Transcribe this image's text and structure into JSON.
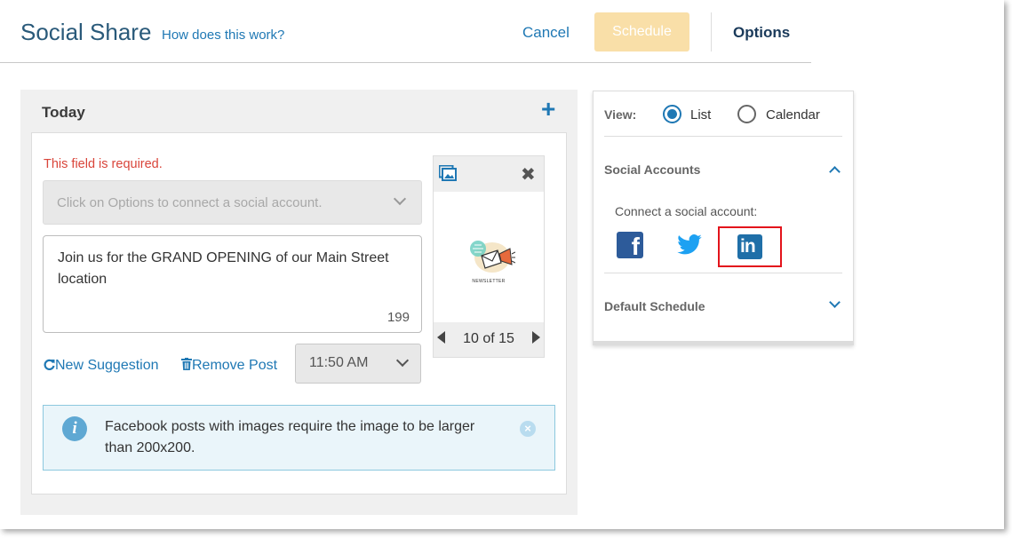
{
  "header": {
    "title": "Social Share",
    "help_link": "How does this work?",
    "cancel_label": "Cancel",
    "schedule_label": "Schedule",
    "options_label": "Options"
  },
  "post": {
    "day_title": "Today",
    "add_icon": "plus-icon",
    "error_text": "This field is required.",
    "account_placeholder": "Click on Options to connect a social account.",
    "text": "Join us for the GRAND OPENING of our Main Street location",
    "char_count": "199",
    "image": {
      "caption": "NEWSLETTER",
      "pager_text": "10 of 15",
      "close_glyph": "✖"
    },
    "new_suggestion_label": "New Suggestion",
    "remove_post_label": "Remove Post",
    "time_value": "11:50 AM",
    "info_text": "Facebook posts with images require the image to be larger than 200x200.",
    "info_glyph": "i",
    "info_close_glyph": "×"
  },
  "options": {
    "view_label": "View:",
    "view_options": [
      {
        "label": "List",
        "selected": true
      },
      {
        "label": "Calendar",
        "selected": false
      }
    ],
    "social_accounts_title": "Social Accounts",
    "connect_label": "Connect a social account:",
    "accounts": [
      "facebook-icon",
      "twitter-icon",
      "linkedin-icon"
    ],
    "default_schedule_title": "Default Schedule"
  },
  "colors": {
    "accent": "#1f78b4",
    "error": "#d9453a",
    "schedule_disabled": "#f9dfa8",
    "highlight_box": "#e3131b"
  }
}
